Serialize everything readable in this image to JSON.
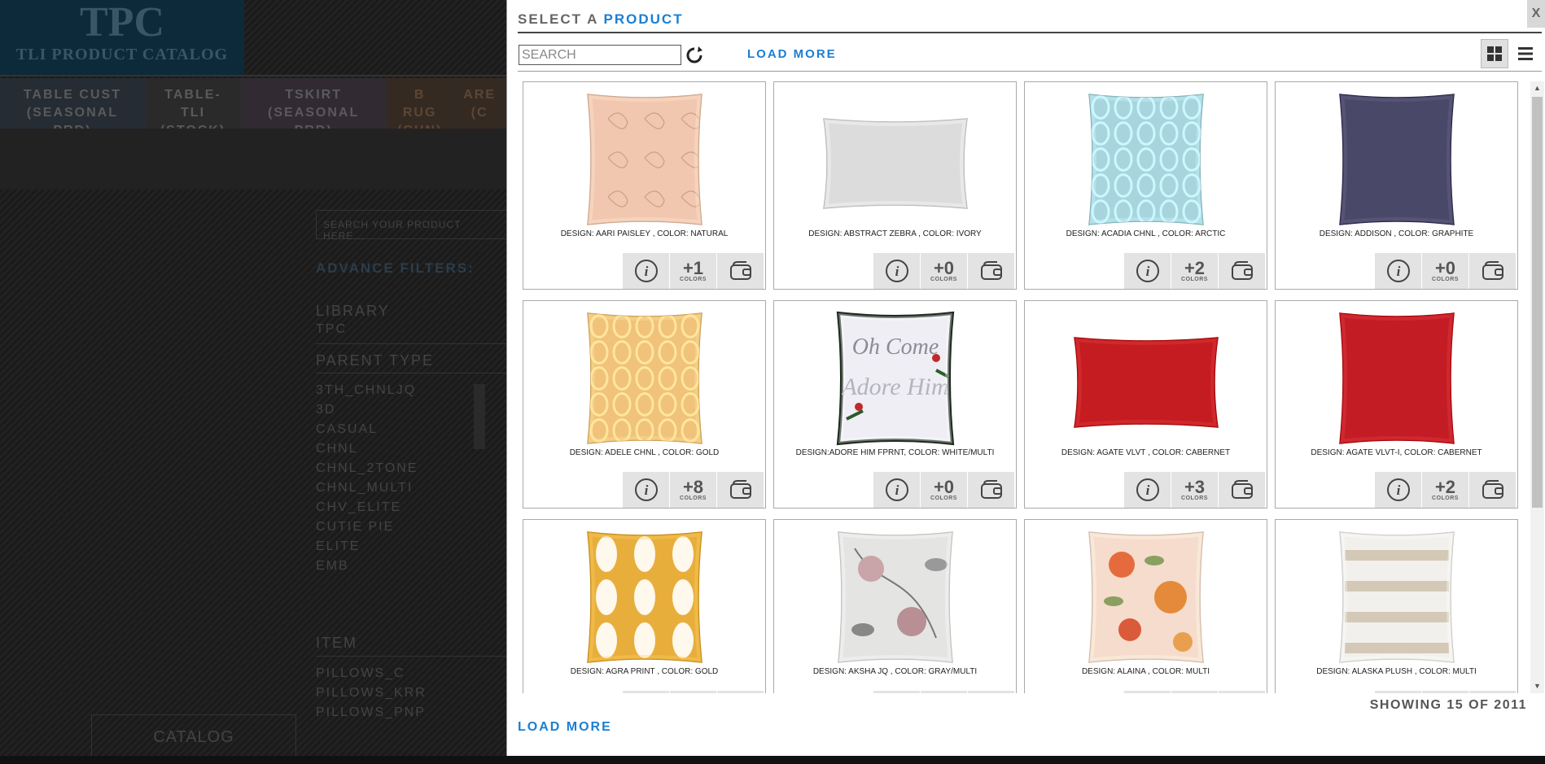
{
  "background_app": {
    "logo_big": "TPC",
    "logo_small": "TLI PRODUCT CATALOG",
    "tabs": [
      {
        "line1": "TABLE CUST",
        "line2": "(SEASONAL PRD)"
      },
      {
        "line1": "TABLE-TLI",
        "line2": "(STOCK)"
      },
      {
        "line1": "TSKIRT",
        "line2": "(SEASONAL PRD)"
      },
      {
        "line1": "B RUG",
        "line2": "(CHN)"
      },
      {
        "line1": "ARE",
        "line2": "(C"
      }
    ],
    "search_placeholder": "SEARCH YOUR PRODUCT HERE...",
    "advance_filters": "ADVANCE FILTERS:",
    "library_label": "LIBRARY",
    "library_value": "TPC",
    "parent_type_label": "PARENT TYPE",
    "parent_types": [
      "3TH_CHNLJQ",
      "3D",
      "CASUAL",
      "CHNL",
      "CHNL_2TONE",
      "CHNL_MULTI",
      "CHV_ELITE",
      "CUTIE PIE",
      "ELITE",
      "EMB"
    ],
    "item_label": "ITEM",
    "items": [
      "PILLOWS_C",
      "PILLOWS_KRR",
      "PILLOWS_PNP"
    ],
    "catalog_button": "CATALOG"
  },
  "modal": {
    "title_prefix": "SELECT A ",
    "title_accent": "PRODUCT",
    "close_label": "X",
    "search_placeholder": "SEARCH",
    "load_more_top": "LOAD MORE",
    "showing_text": "SHOWING 15 OF 2011",
    "load_more_bottom": "LOAD MORE",
    "colors_label": "COLORS",
    "products": [
      {
        "label": "DESIGN: AARI PAISLEY , COLOR: NATURAL",
        "colors": "+1",
        "shape": "square",
        "color": "#f2c7b0",
        "pattern": "paisley"
      },
      {
        "label": "DESIGN: ABSTRACT ZEBRA , COLOR: IVORY",
        "colors": "+0",
        "shape": "rect",
        "color": "#dcdcdc",
        "pattern": "plain"
      },
      {
        "label": "DESIGN: ACADIA CHNL , COLOR: ARCTIC",
        "colors": "+2",
        "shape": "square",
        "color": "#a8d4de",
        "pattern": "lattice"
      },
      {
        "label": "DESIGN: ADDISON , COLOR: GRAPHITE",
        "colors": "+0",
        "shape": "square",
        "color": "#4a4868",
        "pattern": "plain"
      },
      {
        "label": "DESIGN: ADELE CHNL , COLOR: GOLD",
        "colors": "+8",
        "shape": "square",
        "color": "#f0c27a",
        "pattern": "lattice"
      },
      {
        "label": "DESIGN:ADORE HIM FPRNT, COLOR: WHITE/MULTI",
        "colors": "+0",
        "shape": "square",
        "color": "#eeeef4",
        "pattern": "script",
        "script_text": "Oh Come Adore Him"
      },
      {
        "label": "DESIGN: AGATE VLVT , COLOR: CABERNET",
        "colors": "+3",
        "shape": "rect",
        "color": "#c41c20",
        "pattern": "plain"
      },
      {
        "label": "DESIGN: AGATE VLVT-I, COLOR: CABERNET",
        "colors": "+2",
        "shape": "square",
        "color": "#c41c24",
        "pattern": "plain"
      },
      {
        "label": "DESIGN: AGRA PRINT , COLOR: GOLD",
        "colors": "",
        "shape": "square",
        "color": "#e8ae3c",
        "pattern": "damask"
      },
      {
        "label": "DESIGN: AKSHA JQ , COLOR: GRAY/MULTI",
        "colors": "",
        "shape": "square",
        "color": "#e4e4e2",
        "pattern": "floral"
      },
      {
        "label": "DESIGN: ALAINA , COLOR: MULTI",
        "colors": "",
        "shape": "square",
        "color": "#f6dccc",
        "pattern": "floral2"
      },
      {
        "label": "DESIGN: ALASKA PLUSH , COLOR: MULTI",
        "colors": "",
        "shape": "square",
        "color": "#f2f0ec",
        "pattern": "stripes"
      }
    ]
  }
}
